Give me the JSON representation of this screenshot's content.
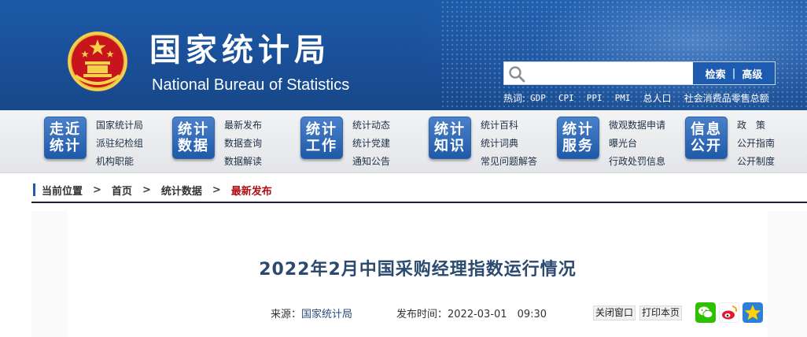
{
  "header": {
    "title_cn": "国家统计局",
    "title_en": "National Bureau of Statistics",
    "search": {
      "placeholder": "",
      "search_label": "检索",
      "separator": "|",
      "advanced_label": "高级"
    },
    "hotwords": {
      "label": "热词:",
      "items": [
        "GDP",
        "CPI",
        "PPI",
        "PMI",
        "总人口",
        "社会消费品零售总额"
      ]
    }
  },
  "nav": [
    {
      "badge": [
        "走近",
        "统计"
      ],
      "links": [
        "国家统计局",
        "派驻纪检组",
        "机构职能"
      ]
    },
    {
      "badge": [
        "统计",
        "数据"
      ],
      "links": [
        "最新发布",
        "数据查询",
        "数据解读"
      ]
    },
    {
      "badge": [
        "统计",
        "工作"
      ],
      "links": [
        "统计动态",
        "统计党建",
        "通知公告"
      ]
    },
    {
      "badge": [
        "统计",
        "知识"
      ],
      "links": [
        "统计百科",
        "统计词典",
        "常见问题解答"
      ]
    },
    {
      "badge": [
        "统计",
        "服务"
      ],
      "links": [
        "微观数据申请",
        "曝光台",
        "行政处罚信息"
      ]
    },
    {
      "badge": [
        "信息",
        "公开"
      ],
      "links": [
        "政　策",
        "公开指南",
        "公开制度"
      ]
    }
  ],
  "breadcrumb": {
    "label": "当前位置",
    "sep": ">",
    "items": [
      "首页",
      "统计数据",
      "最新发布"
    ]
  },
  "article": {
    "title": "2022年2月中国采购经理指数运行情况",
    "source_label": "来源：",
    "source_value": "国家统计局",
    "time_label": "发布时间：",
    "time_value": "2022-03-01　09:30",
    "close_label": "关闭窗口",
    "print_label": "打印本页"
  },
  "colors": {
    "header_blue": "#1a4f98",
    "badge_blue": "#1f5aa8",
    "current_red": "#b00f12",
    "wechat_green": "#2dc100",
    "weibo_red": "#e6162d",
    "qzone_blue": "#2e7fd6"
  },
  "icons": {
    "emblem": "national-emblem-icon",
    "search": "search-icon",
    "share": [
      "wechat-icon",
      "weibo-icon",
      "qzone-icon"
    ]
  }
}
